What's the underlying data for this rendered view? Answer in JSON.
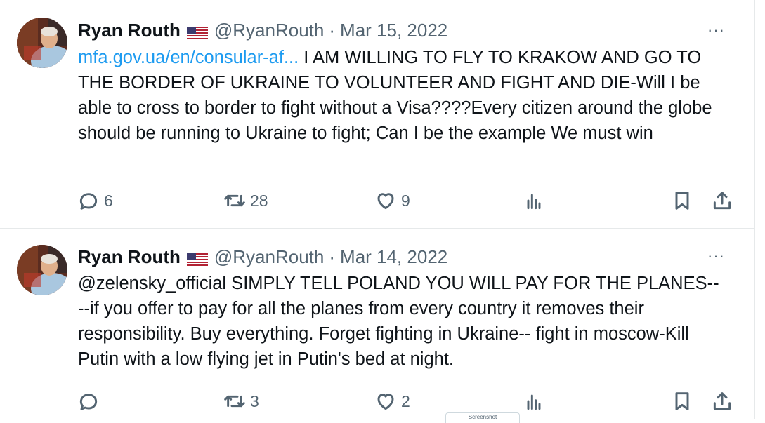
{
  "tweets": [
    {
      "author": {
        "name": "Ryan Routh",
        "handle": "@RyanRouth",
        "flag": "us-flag-icon"
      },
      "separator": "·",
      "date": "Mar 15, 2022",
      "link_text": "mfa.gov.ua/en/consular-af...",
      "text": " I AM WILLING TO FLY TO KRAKOW AND GO TO THE BORDER OF UKRAINE TO VOLUNTEER AND FIGHT AND DIE-Will I be able to cross to border to fight without a Visa????Every citizen around the globe should be running to Ukraine to fight; Can I be the example We must win",
      "more": "···",
      "actions": {
        "replies": "6",
        "retweets": "28",
        "likes": "9"
      }
    },
    {
      "author": {
        "name": "Ryan Routh",
        "handle": "@RyanRouth",
        "flag": "us-flag-icon"
      },
      "separator": "·",
      "date": "Mar 14, 2022",
      "link_text": "",
      "text": "@zelensky_official SIMPLY TELL POLAND YOU WILL PAY FOR THE PLANES----if you offer to pay for all the planes from every country it removes their responsibility.  Buy everything.  Forget fighting in Ukraine-- fight in moscow-Kill Putin with a low flying jet in Putin's bed at night.",
      "more": "···",
      "actions": {
        "replies": "",
        "retweets": "3",
        "likes": "2"
      }
    }
  ],
  "colors": {
    "link": "#1d9bf0",
    "secondary": "#536471",
    "text": "#0f1419",
    "divider": "#e6e9ea"
  },
  "tooltip": {
    "text": "Screenshot"
  }
}
